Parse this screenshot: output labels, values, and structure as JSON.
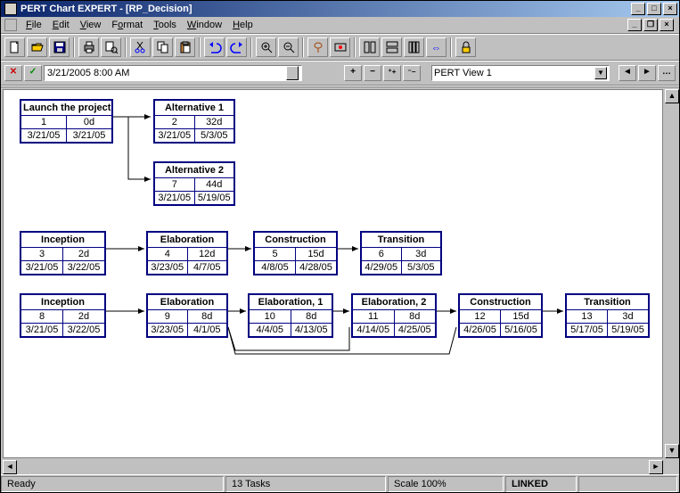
{
  "title": "PERT Chart EXPERT - [RP_Decision]",
  "menus": [
    "File",
    "Edit",
    "View",
    "Format",
    "Tools",
    "Window",
    "Help"
  ],
  "date_field": "3/21/2005 8:00 AM",
  "view_combo": "PERT View 1",
  "status": {
    "ready": "Ready",
    "tasks": "13 Tasks",
    "scale": "Scale 100%",
    "linked": "LINKED"
  },
  "nodes": {
    "launch": {
      "title": "Launch the project",
      "id": "1",
      "dur": "0d",
      "d1": "3/21/05",
      "d2": "3/21/05"
    },
    "alt1": {
      "title": "Alternative 1",
      "id": "2",
      "dur": "32d",
      "d1": "3/21/05",
      "d2": "5/3/05"
    },
    "alt2": {
      "title": "Alternative 2",
      "id": "7",
      "dur": "44d",
      "d1": "3/21/05",
      "d2": "5/19/05"
    },
    "inc1": {
      "title": "Inception",
      "id": "3",
      "dur": "2d",
      "d1": "3/21/05",
      "d2": "3/22/05"
    },
    "elab1": {
      "title": "Elaboration",
      "id": "4",
      "dur": "12d",
      "d1": "3/23/05",
      "d2": "4/7/05"
    },
    "cons1": {
      "title": "Construction",
      "id": "5",
      "dur": "15d",
      "d1": "4/8/05",
      "d2": "4/28/05"
    },
    "tran1": {
      "title": "Transition",
      "id": "6",
      "dur": "3d",
      "d1": "4/29/05",
      "d2": "5/3/05"
    },
    "inc2": {
      "title": "Inception",
      "id": "8",
      "dur": "2d",
      "d1": "3/21/05",
      "d2": "3/22/05"
    },
    "elab2": {
      "title": "Elaboration",
      "id": "9",
      "dur": "8d",
      "d1": "3/23/05",
      "d2": "4/1/05"
    },
    "elab21": {
      "title": "Elaboration, 1",
      "id": "10",
      "dur": "8d",
      "d1": "4/4/05",
      "d2": "4/13/05"
    },
    "elab22": {
      "title": "Elaboration, 2",
      "id": "11",
      "dur": "8d",
      "d1": "4/14/05",
      "d2": "4/25/05"
    },
    "cons2": {
      "title": "Construction",
      "id": "12",
      "dur": "15d",
      "d1": "4/26/05",
      "d2": "5/16/05"
    },
    "tran2": {
      "title": "Transition",
      "id": "13",
      "dur": "3d",
      "d1": "5/17/05",
      "d2": "5/19/05"
    }
  },
  "chart_data": {
    "type": "table",
    "title": "PERT network (RP_Decision)",
    "series": [
      {
        "id": 1,
        "name": "Launch the project",
        "duration_days": 0,
        "start": "3/21/05",
        "finish": "3/21/05",
        "predecessors": []
      },
      {
        "id": 2,
        "name": "Alternative 1",
        "duration_days": 32,
        "start": "3/21/05",
        "finish": "5/3/05",
        "predecessors": [
          1
        ]
      },
      {
        "id": 7,
        "name": "Alternative 2",
        "duration_days": 44,
        "start": "3/21/05",
        "finish": "5/19/05",
        "predecessors": [
          1
        ]
      },
      {
        "id": 3,
        "name": "Inception",
        "duration_days": 2,
        "start": "3/21/05",
        "finish": "3/22/05",
        "predecessors": []
      },
      {
        "id": 4,
        "name": "Elaboration",
        "duration_days": 12,
        "start": "3/23/05",
        "finish": "4/7/05",
        "predecessors": [
          3
        ]
      },
      {
        "id": 5,
        "name": "Construction",
        "duration_days": 15,
        "start": "4/8/05",
        "finish": "4/28/05",
        "predecessors": [
          4
        ]
      },
      {
        "id": 6,
        "name": "Transition",
        "duration_days": 3,
        "start": "4/29/05",
        "finish": "5/3/05",
        "predecessors": [
          5
        ]
      },
      {
        "id": 8,
        "name": "Inception",
        "duration_days": 2,
        "start": "3/21/05",
        "finish": "3/22/05",
        "predecessors": []
      },
      {
        "id": 9,
        "name": "Elaboration",
        "duration_days": 8,
        "start": "3/23/05",
        "finish": "4/1/05",
        "predecessors": [
          8
        ]
      },
      {
        "id": 10,
        "name": "Elaboration, 1",
        "duration_days": 8,
        "start": "4/4/05",
        "finish": "4/13/05",
        "predecessors": [
          9
        ]
      },
      {
        "id": 11,
        "name": "Elaboration, 2",
        "duration_days": 8,
        "start": "4/14/05",
        "finish": "4/25/05",
        "predecessors": [
          10,
          9
        ]
      },
      {
        "id": 12,
        "name": "Construction",
        "duration_days": 15,
        "start": "4/26/05",
        "finish": "5/16/05",
        "predecessors": [
          11,
          9
        ]
      },
      {
        "id": 13,
        "name": "Transition",
        "duration_days": 3,
        "start": "5/17/05",
        "finish": "5/19/05",
        "predecessors": [
          12
        ]
      }
    ]
  }
}
